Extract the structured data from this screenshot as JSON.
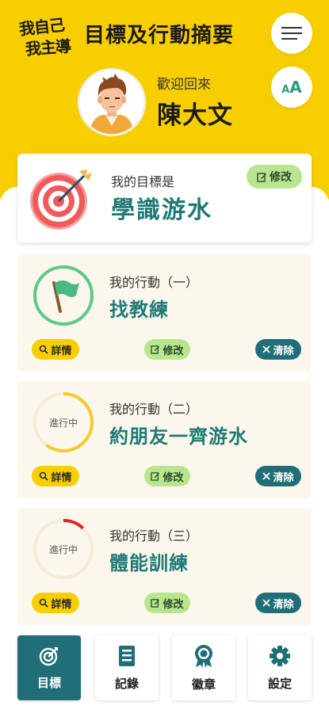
{
  "header": {
    "logo_line1": "我自己",
    "logo_line2": "我主導",
    "title": "目標及行動摘要",
    "menu_icon": "hamburger-icon",
    "font_size_small": "A",
    "font_size_big": "A"
  },
  "user": {
    "welcome": "歡迎回來",
    "name": "陳大文"
  },
  "goal": {
    "label": "我的目標是",
    "text": "學識游水",
    "edit_label": "修改"
  },
  "actions": [
    {
      "label": "我的行動（一）",
      "title": "找教練",
      "status_text": "",
      "progress": 1.0,
      "detail_label": "詳情",
      "edit_label": "修改",
      "clear_label": "清除"
    },
    {
      "label": "我的行動（二）",
      "title": "約朋友一齊游水",
      "status_text": "進行中",
      "progress": 0.6,
      "detail_label": "詳情",
      "edit_label": "修改",
      "clear_label": "清除"
    },
    {
      "label": "我的行動（三）",
      "title": "體能訓練",
      "status_text": "進行中",
      "progress": 0.12,
      "detail_label": "詳情",
      "edit_label": "修改",
      "clear_label": "清除"
    }
  ],
  "nav": {
    "goals": "目標",
    "records": "記錄",
    "badges": "徽章",
    "settings": "設定"
  },
  "colors": {
    "brand_yellow": "#f7cf00",
    "teal": "#1f7a75",
    "dark_teal": "#1f6e78",
    "green_pill": "#b8e58e",
    "card_bg": "#fbf7ec",
    "progress_yellow": "#f2cc2a",
    "progress_red": "#e0262a",
    "ring_green": "#5cc98a"
  }
}
